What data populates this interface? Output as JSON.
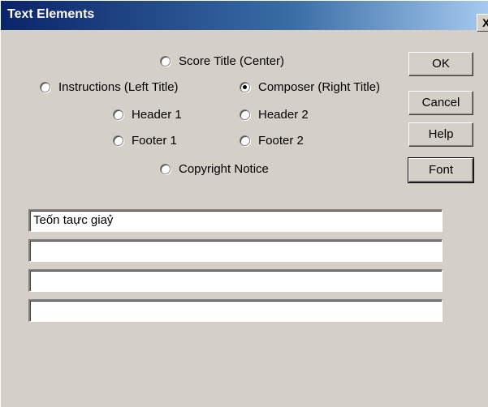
{
  "window": {
    "title": "Text Elements",
    "close_glyph": "X"
  },
  "radios": [
    {
      "label": "Score Title (Center)",
      "checked": false
    },
    {
      "label": "Instructions (Left Title)",
      "checked": false
    },
    {
      "label": "Composer (Right Title)",
      "checked": true
    },
    {
      "label": "Header 1",
      "checked": false
    },
    {
      "label": "Header 2",
      "checked": false
    },
    {
      "label": "Footer 1",
      "checked": false
    },
    {
      "label": "Footer 2",
      "checked": false
    },
    {
      "label": "Copyright Notice",
      "checked": false
    }
  ],
  "buttons": {
    "ok": "OK",
    "cancel": "Cancel",
    "help": "Help",
    "font": "Font"
  },
  "fields": [
    {
      "value": "Teốn taực giaỷ"
    },
    {
      "value": ""
    },
    {
      "value": ""
    },
    {
      "value": ""
    }
  ],
  "colors": {
    "titlebar_start": "#0a246a",
    "titlebar_end": "#a6caf0",
    "face": "#d4d0c8"
  }
}
